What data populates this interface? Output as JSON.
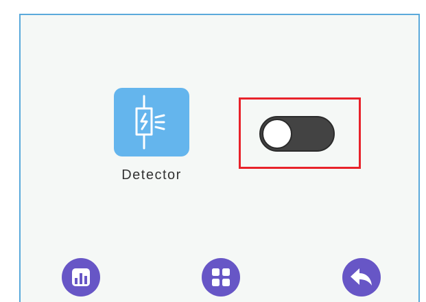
{
  "device": {
    "label": "Detector",
    "icon": "detector-icon",
    "accent_color": "#64b5ed"
  },
  "power_toggle": {
    "state": "off",
    "track_color": "#434343",
    "highlight_color": "#e8222a"
  },
  "bottom_nav": [
    {
      "icon": "bar-chart-icon",
      "color": "#6756c6"
    },
    {
      "icon": "grid-icon",
      "color": "#6756c6"
    },
    {
      "icon": "back-arrow-icon",
      "color": "#6756c6"
    }
  ]
}
